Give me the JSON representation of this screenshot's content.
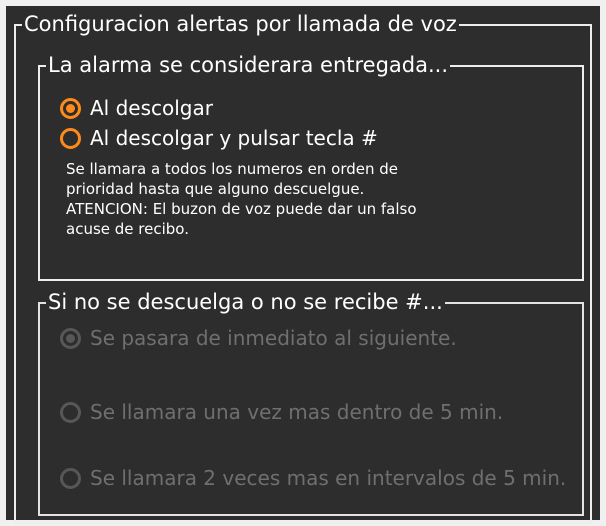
{
  "panel": {
    "title": "Configuracion alertas por llamada de voz"
  },
  "delivery": {
    "legend": "La alarma se considerara entregada...",
    "options": [
      {
        "label": "Al descolgar",
        "checked": true,
        "enabled": true
      },
      {
        "label": "Al descolgar y pulsar tecla #",
        "checked": false,
        "enabled": true
      }
    ],
    "help_lines": [
      "Se llamara a todos los numeros en orden de",
      "prioridad hasta que alguno descuelgue.",
      "ATENCION: El buzon de voz puede dar un falso",
      "acuse de recibo."
    ]
  },
  "fallback": {
    "legend": "Si no se descuelga o no se recibe #...",
    "options": [
      {
        "label": "Se pasara de inmediato al siguiente.",
        "checked": true,
        "enabled": false
      },
      {
        "label": "Se llamara una vez mas dentro de 5 min.",
        "checked": false,
        "enabled": false
      },
      {
        "label": "Se llamara 2  veces mas en intervalos de 5 min.",
        "checked": false,
        "enabled": false
      }
    ]
  },
  "colors": {
    "background": "#2d2d2d",
    "accent": "#ff8a1c",
    "text": "#ffffff",
    "disabled_text": "#6f6f6f",
    "disabled_radio": "#575757",
    "border": "#ededed"
  }
}
